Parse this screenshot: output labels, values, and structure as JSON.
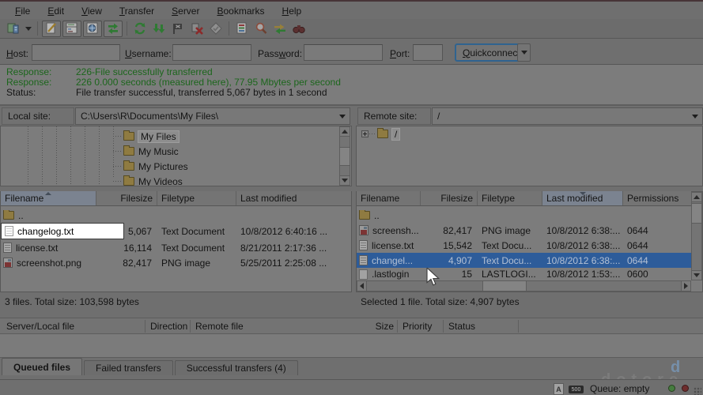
{
  "menu": {
    "items": [
      {
        "pre": "",
        "key": "F",
        "post": "ile"
      },
      {
        "pre": "",
        "key": "E",
        "post": "dit"
      },
      {
        "pre": "",
        "key": "V",
        "post": "iew"
      },
      {
        "pre": "",
        "key": "T",
        "post": "ransfer"
      },
      {
        "pre": "",
        "key": "S",
        "post": "erver"
      },
      {
        "pre": "",
        "key": "B",
        "post": "ookmarks"
      },
      {
        "pre": "",
        "key": "H",
        "post": "elp"
      }
    ]
  },
  "quickconnect": {
    "host": {
      "pre": "",
      "key": "H",
      "post": "ost:"
    },
    "username": {
      "pre": "",
      "key": "U",
      "post": "sername:"
    },
    "password": {
      "pre": "Pass",
      "key": "w",
      "post": "ord:"
    },
    "port": {
      "pre": "",
      "key": "P",
      "post": "ort:"
    },
    "button": {
      "pre": "",
      "key": "Q",
      "post": "uickconnect"
    }
  },
  "log": {
    "lines": [
      {
        "label": "Response:",
        "text": "226-File successfully transferred"
      },
      {
        "label": "Response:",
        "text": "226 0.000 seconds (measured here), 77.95 Mbytes per second"
      },
      {
        "label": "Status:",
        "text": "File transfer successful, transferred 5,067 bytes in 1 second"
      }
    ]
  },
  "local": {
    "label": "Local site:",
    "path": "C:\\Users\\R\\Documents\\My Files\\",
    "tree": [
      "My Files",
      "My Music",
      "My Pictures",
      "My Videos"
    ],
    "columns": [
      "Filename",
      "Filesize",
      "Filetype",
      "Last modified"
    ],
    "rows": [
      {
        "name": "..",
        "size": "",
        "type": "",
        "modified": ""
      },
      {
        "name": "changelog.txt",
        "size": "5,067",
        "type": "Text Document",
        "modified": "10/8/2012 6:40:16 ..."
      },
      {
        "name": "license.txt",
        "size": "16,114",
        "type": "Text Document",
        "modified": "8/21/2011 2:17:36 ..."
      },
      {
        "name": "screenshot.png",
        "size": "82,417",
        "type": "PNG image",
        "modified": "5/25/2011 2:25:08 ..."
      }
    ],
    "status": "3 files. Total size: 103,598 bytes"
  },
  "remote": {
    "label": "Remote site:",
    "path": "/",
    "tree_root": "/",
    "columns": [
      "Filename",
      "Filesize",
      "Filetype",
      "Last modified",
      "Permissions"
    ],
    "rows": [
      {
        "name": "..",
        "size": "",
        "type": "",
        "modified": "",
        "perms": ""
      },
      {
        "name": "screensh...",
        "size": "82,417",
        "type": "PNG image",
        "modified": "10/8/2012 6:38:...",
        "perms": "0644"
      },
      {
        "name": "license.txt",
        "size": "15,542",
        "type": "Text Docu...",
        "modified": "10/8/2012 6:38:...",
        "perms": "0644"
      },
      {
        "name": "changel...",
        "size": "4,907",
        "type": "Text Docu...",
        "modified": "10/8/2012 6:38:...",
        "perms": "0644"
      },
      {
        "name": ".lastlogin",
        "size": "15",
        "type": "LASTLOGI...",
        "modified": "10/8/2012 1:53:...",
        "perms": "0600"
      }
    ],
    "status": "Selected 1 file. Total size: 4,907 bytes"
  },
  "queue": {
    "columns": [
      "Server/Local file",
      "Direction",
      "Remote file",
      "Size",
      "Priority",
      "Status"
    ],
    "tabs": [
      "Queued files",
      "Failed transfers",
      "Successful transfers (4)"
    ]
  },
  "statusbar": {
    "queue_text": "Queue: empty",
    "type_indicator": "A",
    "badge": "500"
  },
  "watermark": {
    "text": "dotore",
    "d": "d"
  }
}
